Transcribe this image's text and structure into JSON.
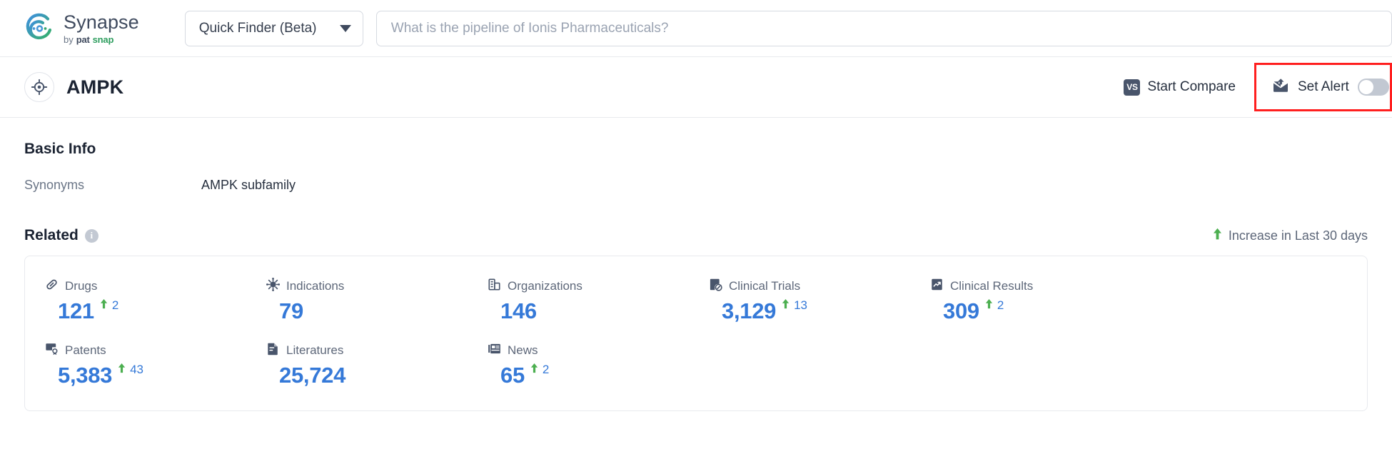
{
  "brand": {
    "name": "Synapse",
    "by": "by",
    "pat": "pat",
    "snap": "snap",
    "logo_icon": "synapse-swirl-logo"
  },
  "search": {
    "mode_label": "Quick Finder (Beta)",
    "dropdown_icon": "chevron-down-icon",
    "placeholder": "What is the pipeline of Ionis Pharmaceuticals?",
    "value": ""
  },
  "entity": {
    "icon": "target-crosshair-icon",
    "title": "AMPK"
  },
  "actions": {
    "compare_label": "Start Compare",
    "compare_icon": "vs-badge-icon",
    "compare_badge_text": "VS",
    "alert_label": "Set Alert",
    "alert_icon": "mail-alert-icon",
    "alert_toggle_state": "off",
    "highlight_color": "#ff1f1f"
  },
  "basic_info": {
    "title": "Basic Info",
    "rows": [
      {
        "key": "Synonyms",
        "value": "AMPK subfamily"
      }
    ]
  },
  "related": {
    "title": "Related",
    "info_icon": "info-circle-icon",
    "info_char": "i",
    "legend_label": "Increase in Last 30 days",
    "legend_icon": "arrow-up-icon",
    "increase_color": "#4caf50",
    "value_color": "#3579d8",
    "stats": [
      {
        "label": "Drugs",
        "icon": "pill-icon",
        "value": "121",
        "delta": "2"
      },
      {
        "label": "Indications",
        "icon": "virus-icon",
        "value": "79",
        "delta": ""
      },
      {
        "label": "Organizations",
        "icon": "building-icon",
        "value": "146",
        "delta": ""
      },
      {
        "label": "Clinical Trials",
        "icon": "clinical-trial-icon",
        "value": "3,129",
        "delta": "13"
      },
      {
        "label": "Clinical Results",
        "icon": "clinical-result-icon",
        "value": "309",
        "delta": "2"
      },
      {
        "label": "Patents",
        "icon": "patent-icon",
        "value": "5,383",
        "delta": "43"
      },
      {
        "label": "Literatures",
        "icon": "literature-icon",
        "value": "25,724",
        "delta": ""
      },
      {
        "label": "News",
        "icon": "news-icon",
        "value": "65",
        "delta": "2"
      }
    ]
  }
}
